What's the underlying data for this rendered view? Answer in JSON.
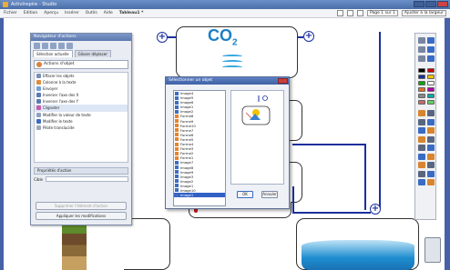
{
  "window": {
    "title": "ActivInspire - Studio"
  },
  "menubar": {
    "items": [
      "Fichier",
      "Edition",
      "Aperçu",
      "Insérer",
      "Outils",
      "Aide",
      "Tableau1 *"
    ],
    "active_index": 6,
    "page_label": "Page 1 sur 1",
    "adapt_label": "Ajuster à la largeur"
  },
  "canvas": {
    "co2_text": "CO",
    "co2_sub": "2"
  },
  "navigator": {
    "title": "Navigateur d'actions",
    "tabs": [
      "Sélection actuelle",
      "Glisser déplacer"
    ],
    "active_tab": 0,
    "selector": "Actions d'objet",
    "actions": [
      "Effacer les objets",
      "Colonne à la texte",
      "Envoyer",
      "Inverser l'axe des X",
      "Inverser l'axe des Y",
      "Clignoter",
      "Modifier la valeur de texte",
      "Modifier le texte",
      "Pilote translucide"
    ],
    "selected_action": 5,
    "props_header": "Propriétés d'action",
    "prop_label": "Cible",
    "remove_button": "Supprimer l'élément d'action",
    "apply_button": "Appliquer les modifications"
  },
  "dialog": {
    "title": "Sélectionner un objet",
    "objects": [
      "Image4",
      "Image5",
      "Image6",
      "Image1",
      "Image2",
      "Forme8",
      "Forme9",
      "Forme10",
      "Forme7",
      "Forme6",
      "Forme5",
      "Forme4",
      "Forme3",
      "Forme2",
      "Forme1",
      "Image7",
      "Image8",
      "Image9",
      "Image3",
      "Image2",
      "Image1",
      "Image10",
      "Image1"
    ],
    "selected_index": 22,
    "ok_label": "OK",
    "cancel_label": "Annuler"
  }
}
